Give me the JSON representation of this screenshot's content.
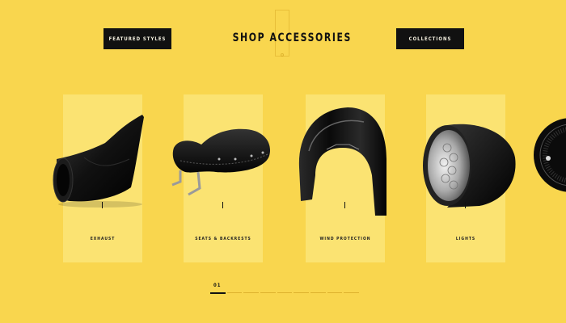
{
  "header": {
    "title": "SHOP ACCESSORIES",
    "featured_label": "FEATURED STYLES",
    "collections_label": "COLLECTIONS"
  },
  "categories": [
    {
      "label": "EXHAUST",
      "icon": "exhaust-icon"
    },
    {
      "label": "SEATS & BACKRESTS",
      "icon": "seat-icon"
    },
    {
      "label": "WIND PROTECTION",
      "icon": "windshield-icon"
    },
    {
      "label": "LIGHTS",
      "icon": "headlight-icon"
    }
  ],
  "pager": {
    "current": "01",
    "segments": 9,
    "active_index": 0
  },
  "colors": {
    "background": "#f9d64e",
    "card": "#fbe372",
    "button": "#111111",
    "text": "#111111"
  }
}
